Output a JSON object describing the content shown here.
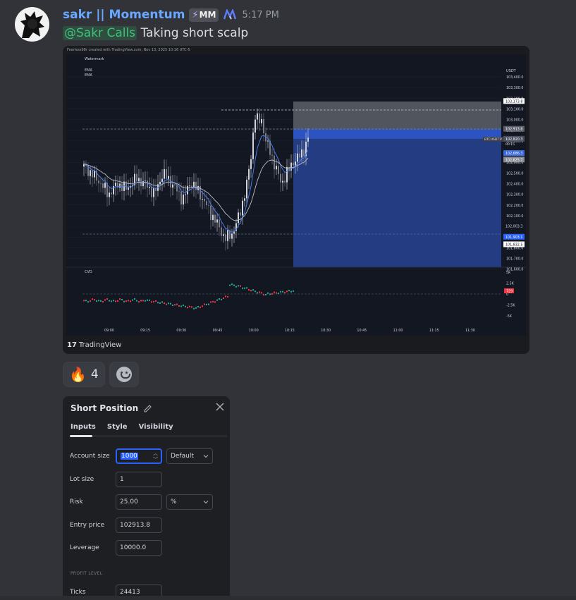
{
  "message": {
    "username": "sakr || Momentum",
    "badge_icon": "lightning-bolt-icon",
    "badge_text": "MM",
    "app_icon": "mi-logo-icon",
    "timestamp": "5:17 PM",
    "mention": "@Sakr Calls",
    "text": "Taking short scalp"
  },
  "chart": {
    "credit": "Fearless98r created with TradingView.com, Nov 13, 2025 10:16 UTC-5",
    "watermark": "Watermark",
    "ema_label_1": "EMA",
    "ema_label_2": "EMA",
    "cvd_label": "CVD",
    "currency": "USDT",
    "symbol_label": "BTCUSDT.P",
    "price_ticks": [
      "103,400.0",
      "103,300.0",
      "103,200.0",
      "103,100.0",
      "103,000.0",
      "102,900.0",
      "102,800.0",
      "102,700.0",
      "102,600.0",
      "102,500.0",
      "102,400.0",
      "102,300.0",
      "102,200.0",
      "102,100.0",
      "102,000.0",
      "101,900.0",
      "101,800.0",
      "101,700.0",
      "101,600.0"
    ],
    "price_labels": {
      "stop": "103,173.8",
      "entry": "102,913.8",
      "current": "102,820.3",
      "countdown": "00:15",
      "ema1": "102,686.3",
      "ema2": "102,625.7",
      "level_mid": "102,003.3",
      "target": "101,903.1",
      "low": "101,832.5"
    },
    "cvd_ticks": [
      "5K",
      "2.5K",
      "0",
      "-2.5K",
      "-5K"
    ],
    "cvd_value": "729",
    "time_ticks": [
      "09:00",
      "09:15",
      "09:30",
      "09:45",
      "10:00",
      "10:15",
      "10:30",
      "10:45",
      "11:00",
      "11:15",
      "11:30"
    ],
    "footer_brand": "TradingView",
    "colors": {
      "up": "#d1d4dc",
      "down": "#787b86",
      "ema_blue": "#4c7ae6",
      "target_zone": "#2a4aa3",
      "stop_zone": "#5d6068"
    }
  },
  "reactions": {
    "fire_emoji": "🔥",
    "fire_count": "4",
    "add_reaction_icon": "smiley-add-icon"
  },
  "dialog": {
    "title": "Short Position",
    "tabs": [
      "Inputs",
      "Style",
      "Visibility"
    ],
    "account_size_label": "Account size",
    "account_size_value": "1000",
    "account_mode": "Default",
    "lot_size_label": "Lot size",
    "lot_size_value": "1",
    "risk_label": "Risk",
    "risk_value": "25.00",
    "risk_unit": "%",
    "entry_label": "Entry price",
    "entry_value": "102913.8",
    "leverage_label": "Leverage",
    "leverage_value": "10000.0",
    "profit_section": "PROFIT LEVEL",
    "ticks_label": "Ticks",
    "ticks_value": "24413"
  }
}
